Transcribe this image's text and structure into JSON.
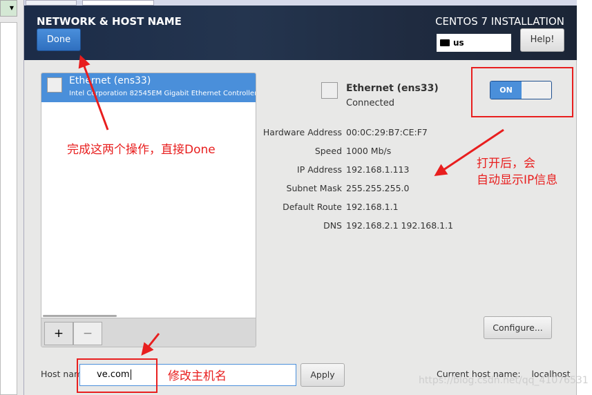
{
  "header": {
    "title": "NETWORK & HOST NAME",
    "done_label": "Done",
    "installation": "CENTOS 7 INSTALLATION",
    "keyboard": "us",
    "help_label": "Help!"
  },
  "device_list": {
    "items": [
      {
        "name": "Ethernet (ens33)",
        "description": "Intel Corporation 82545EM Gigabit Ethernet Controller ("
      }
    ],
    "add_label": "+",
    "remove_label": "−"
  },
  "details": {
    "name": "Ethernet (ens33)",
    "status": "Connected",
    "toggle": "ON",
    "fields": [
      {
        "label": "Hardware Address",
        "value": "00:0C:29:B7:CE:F7"
      },
      {
        "label": "Speed",
        "value": "1000 Mb/s"
      },
      {
        "label": "IP Address",
        "value": "192.168.1.113"
      },
      {
        "label": "Subnet Mask",
        "value": "255.255.255.0"
      },
      {
        "label": "Default Route",
        "value": "192.168.1.1"
      },
      {
        "label": "DNS",
        "value": "192.168.2.1 192.168.1.1"
      }
    ],
    "configure_label": "Configure..."
  },
  "hostname": {
    "label": "Host name:",
    "value": "ve.com",
    "apply_label": "Apply",
    "current_label": "Current host name:",
    "current_value": "localhost"
  },
  "annotations": {
    "done_note": "完成这两个操作，直接Done",
    "toggle_note_1": "打开后，会",
    "toggle_note_2": "自动显示IP信息",
    "hostname_note": "修改主机名"
  },
  "watermark": "https://blog.csdn.net/qq_41076531",
  "colors": {
    "accent": "#4a8fda",
    "annotation": "#e81e1e",
    "header": "#1f2b40"
  }
}
